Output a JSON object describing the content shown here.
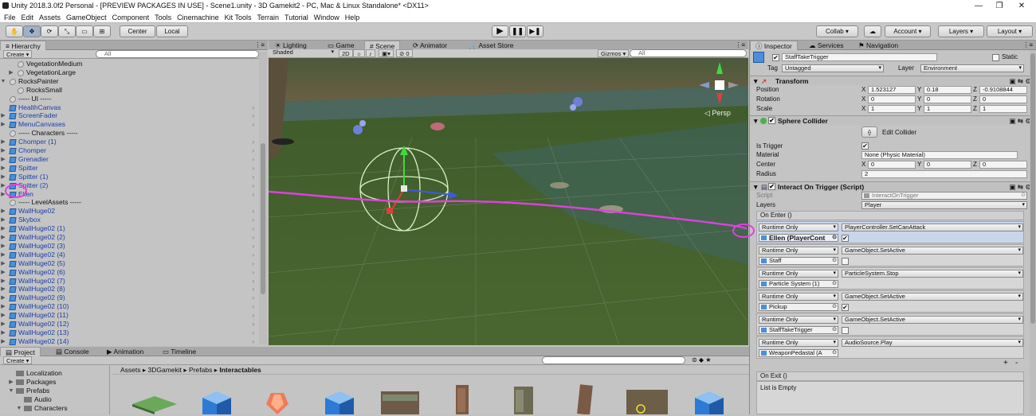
{
  "window": {
    "title": "Unity 2018.3.0f2 Personal - [PREVIEW PACKAGES IN USE] - Scene1.unity - 3D Gamekit2 - PC, Mac & Linux Standalone* <DX11>",
    "minimize": "—",
    "restore": "❐",
    "close": "✕"
  },
  "menu": [
    "File",
    "Edit",
    "Assets",
    "GameObject",
    "Component",
    "Tools",
    "Cinemachine",
    "Kit Tools",
    "Terrain",
    "Tutorial",
    "Window",
    "Help"
  ],
  "toolbar": {
    "center": "Center",
    "local": "Local",
    "collab": "Collab ▾",
    "account": "Account ▾",
    "layers": "Layers",
    "layout": "Layout"
  },
  "hierarchy": {
    "tab": "Hierarchy",
    "create": "Create ▾",
    "search": "All",
    "items": [
      {
        "label": "VegetationMedium",
        "indent": 2,
        "arrow": "",
        "icon": "g",
        "blue": false
      },
      {
        "label": "VegetationLarge",
        "indent": 2,
        "arrow": "▶",
        "icon": "g",
        "blue": false
      },
      {
        "label": "RocksPainter",
        "indent": 1,
        "arrow": "▼",
        "icon": "g",
        "blue": false
      },
      {
        "label": "RocksSmall",
        "indent": 2,
        "arrow": "",
        "icon": "g",
        "blue": false
      },
      {
        "label": "----- UI -----",
        "indent": 1,
        "arrow": "",
        "icon": "g",
        "blue": false
      },
      {
        "label": "HealthCanvas",
        "indent": 1,
        "arrow": "",
        "icon": "b",
        "blue": true
      },
      {
        "label": "ScreenFader",
        "indent": 1,
        "arrow": "▶",
        "icon": "b",
        "blue": true
      },
      {
        "label": "MenuCanvases",
        "indent": 1,
        "arrow": "▶",
        "icon": "b",
        "blue": true
      },
      {
        "label": "----- Characters -----",
        "indent": 1,
        "arrow": "",
        "icon": "g",
        "blue": false
      },
      {
        "label": "Chomper (1)",
        "indent": 1,
        "arrow": "▶",
        "icon": "b",
        "blue": true
      },
      {
        "label": "Chomper",
        "indent": 1,
        "arrow": "▶",
        "icon": "b",
        "blue": true
      },
      {
        "label": "Grenadier",
        "indent": 1,
        "arrow": "▶",
        "icon": "b",
        "blue": true
      },
      {
        "label": "Spitter",
        "indent": 1,
        "arrow": "▶",
        "icon": "b",
        "blue": true
      },
      {
        "label": "Spitter (1)",
        "indent": 1,
        "arrow": "▶",
        "icon": "b",
        "blue": true
      },
      {
        "label": "Spitter (2)",
        "indent": 1,
        "arrow": "▶",
        "icon": "b",
        "blue": true
      },
      {
        "label": "Ellen",
        "indent": 1,
        "arrow": "▶",
        "icon": "b",
        "blue": true
      },
      {
        "label": "----- LevelAssets -----",
        "indent": 1,
        "arrow": "",
        "icon": "g",
        "blue": false
      },
      {
        "label": "WallHuge02",
        "indent": 1,
        "arrow": "▶",
        "icon": "b",
        "blue": true
      },
      {
        "label": "Skybox",
        "indent": 1,
        "arrow": "▶",
        "icon": "b",
        "blue": true
      },
      {
        "label": "WallHuge02 (1)",
        "indent": 1,
        "arrow": "▶",
        "icon": "b",
        "blue": true
      },
      {
        "label": "WallHuge02 (2)",
        "indent": 1,
        "arrow": "▶",
        "icon": "b",
        "blue": true
      },
      {
        "label": "WallHuge02 (3)",
        "indent": 1,
        "arrow": "▶",
        "icon": "b",
        "blue": true
      },
      {
        "label": "WallHuge02 (4)",
        "indent": 1,
        "arrow": "▶",
        "icon": "b",
        "blue": true
      },
      {
        "label": "WallHuge02 (5)",
        "indent": 1,
        "arrow": "▶",
        "icon": "b",
        "blue": true
      },
      {
        "label": "WallHuge02 (6)",
        "indent": 1,
        "arrow": "▶",
        "icon": "b",
        "blue": true
      },
      {
        "label": "WallHuge02 (7)",
        "indent": 1,
        "arrow": "▶",
        "icon": "b",
        "blue": true
      },
      {
        "label": "WallHuge02 (8)",
        "indent": 1,
        "arrow": "▶",
        "icon": "b",
        "blue": true
      },
      {
        "label": "WallHuge02 (9)",
        "indent": 1,
        "arrow": "▶",
        "icon": "b",
        "blue": true
      },
      {
        "label": "WallHuge02 (10)",
        "indent": 1,
        "arrow": "▶",
        "icon": "b",
        "blue": true
      },
      {
        "label": "WallHuge02 (11)",
        "indent": 1,
        "arrow": "▶",
        "icon": "b",
        "blue": true
      },
      {
        "label": "WallHuge02 (12)",
        "indent": 1,
        "arrow": "▶",
        "icon": "b",
        "blue": true
      },
      {
        "label": "WallHuge02 (13)",
        "indent": 1,
        "arrow": "▶",
        "icon": "b",
        "blue": true
      },
      {
        "label": "WallHuge02 (14)",
        "indent": 1,
        "arrow": "▶",
        "icon": "b",
        "blue": true
      }
    ]
  },
  "sceneTabs": {
    "lighting": "Lighting",
    "game": "Game",
    "scene": "Scene",
    "animator": "Animator",
    "assetstore": "Asset Store"
  },
  "sceneBar": {
    "shaded": "Shaded",
    "twod": "2D",
    "gizmos": "Gizmos ▾",
    "search": "All",
    "persp": "◁ Persp"
  },
  "inspector": {
    "tab": "Inspector",
    "services": "Services",
    "navigation": "Navigation",
    "objectName": "StaffTakeTrigger",
    "static": "Static",
    "tagLabel": "Tag",
    "tag": "Untagged",
    "layerLabel": "Layer",
    "layer": "Environment",
    "transform": {
      "title": "Transform",
      "position": "Position",
      "rotation": "Rotation",
      "scale": "Scale",
      "pos": [
        "1.523127",
        "0.18",
        "-0.9108844"
      ],
      "rot": [
        "0",
        "0",
        "0"
      ],
      "scl": [
        "1",
        "1",
        "1"
      ]
    },
    "sphere": {
      "title": "Sphere Collider",
      "editCollider": "Edit Collider",
      "isTrigger": "Is Trigger",
      "material": "Material",
      "materialValue": "None (Physic Material)",
      "center": "Center",
      "centerValues": [
        "0",
        "0",
        "0"
      ],
      "radius": "Radius",
      "radiusValue": "2"
    },
    "script": {
      "title": "Interact On Trigger (Script)",
      "scriptLabel": "Script",
      "scriptValue": "InteractOnTrigger",
      "layersLabel": "Layers",
      "layersValue": "Player",
      "onEnter": "On Enter ()",
      "onExit": "On Exit ()",
      "listEmpty": "List is Empty"
    },
    "events": [
      {
        "mode": "Runtime Only",
        "func": "PlayerController.SetCanAttack",
        "obj": "Ellen (PlayerCont",
        "checked": true
      },
      {
        "mode": "Runtime Only",
        "func": "GameObject.SetActive",
        "obj": "Staff",
        "checked": false
      },
      {
        "mode": "Runtime Only",
        "func": "ParticleSystem.Stop",
        "obj": "Particle System (1)",
        "checked": null
      },
      {
        "mode": "Runtime Only",
        "func": "GameObject.SetActive",
        "obj": "Pickup",
        "checked": true
      },
      {
        "mode": "Runtime Only",
        "func": "GameObject.SetActive",
        "obj": "StaffTakeTrigger",
        "checked": false
      },
      {
        "mode": "Runtime Only",
        "func": "AudioSource.Play",
        "obj": "WeaponPedastal (A",
        "checked": null
      }
    ],
    "axes": [
      "X",
      "Y",
      "Z"
    ],
    "plus": "+",
    "minus": "-"
  },
  "project": {
    "tab": "Project",
    "console": "Console",
    "animation": "Animation",
    "timeline": "Timeline",
    "create": "Create ▾",
    "tree": [
      "Localization",
      "Packages",
      "Prefabs",
      "Audio",
      "Characters"
    ],
    "breadcrumb": [
      "Assets",
      "3DGamekit",
      "Prefabs",
      "Interactables"
    ]
  },
  "colors": {
    "annotation": "#e040e0",
    "selection": "#3d7bd6",
    "assetBlue": "#2d7ad6"
  }
}
